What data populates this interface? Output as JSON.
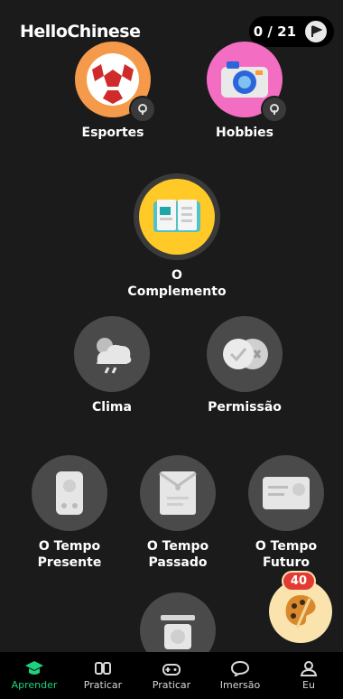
{
  "header": {
    "logo": "HelloChinese",
    "progress": "0 / 21"
  },
  "nodes": {
    "esportes": "Esportes",
    "hobbies": "Hobbies",
    "complemento": "O\nComplemento",
    "clima": "Clima",
    "permissao": "Permissão",
    "tempo_presente": "O Tempo\nPresente",
    "tempo_passado": "O Tempo\nPassado",
    "tempo_futuro": "O Tempo\nFuturo"
  },
  "fab": {
    "badge": "40"
  },
  "bottom_nav": [
    {
      "label": "Aprender"
    },
    {
      "label": "Praticar"
    },
    {
      "label": "Praticar"
    },
    {
      "label": "Imersão"
    },
    {
      "label": "Eu"
    }
  ],
  "colors": {
    "active_nav": "#1fd17f",
    "highlight_node": "#ffc927",
    "badge": "#e23b34"
  }
}
